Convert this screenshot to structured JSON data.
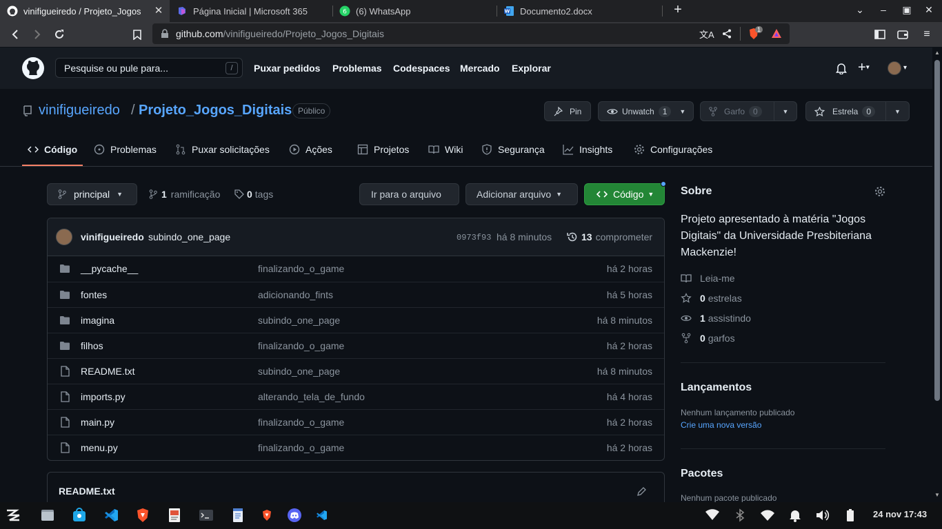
{
  "browser": {
    "tabs": [
      {
        "title": "vinifigueiredo / Projeto_Jogos",
        "icon": "github-icon",
        "active": true
      },
      {
        "title": "Página Inicial | Microsoft 365",
        "icon": "m365-icon"
      },
      {
        "title": "(6) WhatsApp",
        "icon": "whatsapp-icon",
        "badge": "6"
      },
      {
        "title": "Documento2.docx",
        "icon": "word-icon"
      }
    ],
    "url_host": "github.com",
    "url_path": "/vinifigueiredo/Projeto_Jogos_Digitais",
    "shield_badge": "1"
  },
  "github_header": {
    "search_placeholder": "Pesquise ou pule para...",
    "search_key": "/",
    "nav": [
      "Puxar pedidos",
      "Problemas",
      "Codespaces",
      "Mercado",
      "Explorar"
    ]
  },
  "repo": {
    "owner": "vinifigueiredo",
    "separator": "/",
    "name": "Projeto_Jogos_Digitais",
    "visibility": "Público",
    "pin_label": "Pin",
    "unwatch_label": "Unwatch",
    "unwatch_count": "1",
    "fork_label": "Garfo",
    "fork_count": "0",
    "star_label": "Estrela",
    "star_count": "0",
    "tabs": [
      "Código",
      "Problemas",
      "Puxar solicitações",
      "Ações",
      "Projetos",
      "Wiki",
      "Segurança",
      "Insights",
      "Configurações"
    ]
  },
  "main": {
    "branch": "principal",
    "branch_count": "1",
    "branch_label": "ramificação",
    "tag_count": "0",
    "tag_label": "tags",
    "goto_file": "Ir para o arquivo",
    "add_file": "Adicionar arquivo",
    "code_button": "Código",
    "commit": {
      "author": "vinifigueiredo",
      "message": "subindo_one_page",
      "hash": "0973f93",
      "age": "há 8 minutos",
      "count": "13",
      "count_label": "comprometer"
    },
    "files": [
      {
        "name": "__pycache__",
        "type": "folder",
        "message": "finalizando_o_game",
        "age": "há 2 horas"
      },
      {
        "name": "fontes",
        "type": "folder",
        "message": "adicionando_fints",
        "age": "há 5 horas"
      },
      {
        "name": "imagina",
        "type": "folder",
        "message": "subindo_one_page",
        "age": "há 8 minutos"
      },
      {
        "name": "filhos",
        "type": "folder",
        "message": "finalizando_o_game",
        "age": "há 2 horas"
      },
      {
        "name": "README.txt",
        "type": "file",
        "message": "subindo_one_page",
        "age": "há 8 minutos"
      },
      {
        "name": "imports.py",
        "type": "file",
        "message": "alterando_tela_de_fundo",
        "age": "há 4 horas"
      },
      {
        "name": "main.py",
        "type": "file",
        "message": "finalizando_o_game",
        "age": "há 2 horas"
      },
      {
        "name": "menu.py",
        "type": "file",
        "message": "finalizando_o_game",
        "age": "há 2 horas"
      }
    ],
    "readme_title": "README.txt"
  },
  "sidebar": {
    "about_title": "Sobre",
    "description": "Projeto apresentado à matéria \"Jogos Digitais\" da Universidade Presbiteriana Mackenzie!",
    "readme": "Leia-me",
    "stars_count": "0",
    "stars_label": "estrelas",
    "watching_count": "1",
    "watching_label": "assistindo",
    "forks_count": "0",
    "forks_label": "garfos",
    "releases_title": "Lançamentos",
    "releases_none": "Nenhum lançamento publicado",
    "releases_create": "Crie uma nova versão",
    "packages_title": "Pacotes",
    "packages_none": "Nenhum pacote publicado"
  },
  "taskbar": {
    "clock": "24 nov 17:43"
  },
  "colors": {
    "accent_blue": "#58a6ff",
    "code_green": "#238636",
    "tab_underline": "#f78166"
  }
}
